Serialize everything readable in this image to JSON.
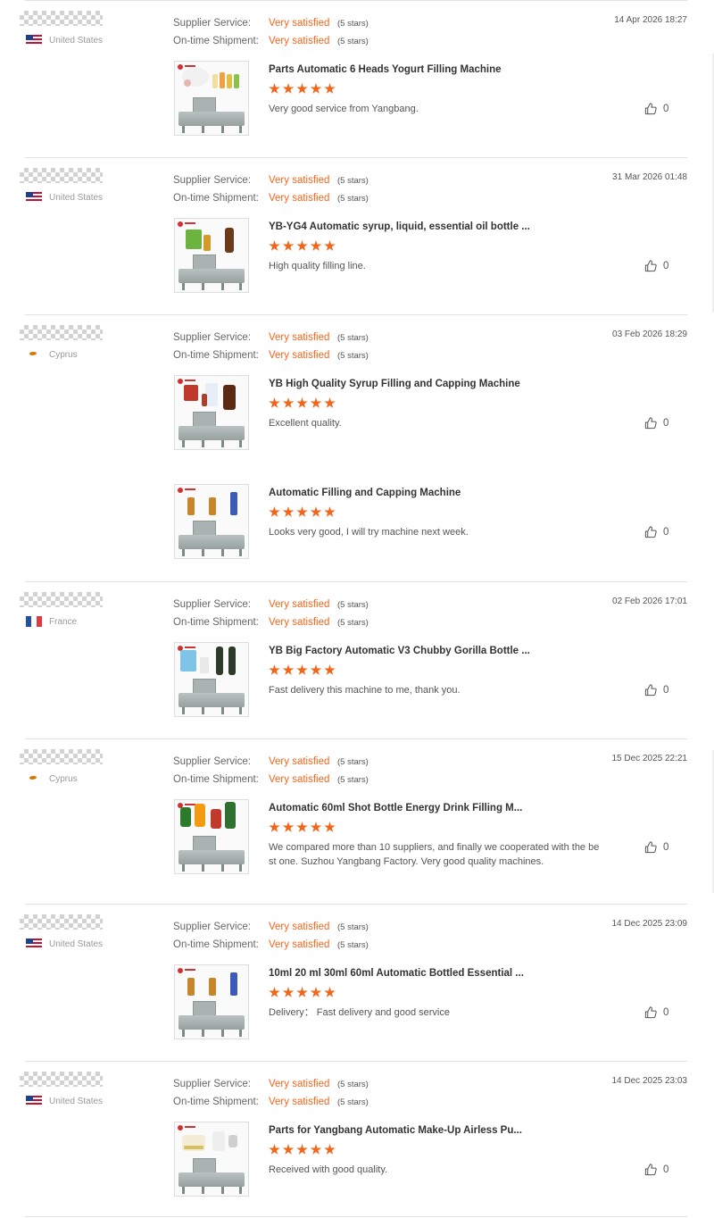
{
  "ratings_labels": {
    "supplier_service": "Supplier Service:",
    "on_time_shipment": "On-time Shipment:"
  },
  "colors": {
    "accent": "#f2661b",
    "text": "#333333",
    "muted": "#999999"
  },
  "reviews": [
    {
      "country": "United States",
      "flag": "us",
      "date": "14 Apr 2026 18:27",
      "supplier_service": "Very satisfied",
      "supplier_service_stars": "(5 stars)",
      "on_time_shipment": "Very satisfied",
      "on_time_shipment_stars": "(5 stars)",
      "products": [
        {
          "title": "Parts Automatic 6 Heads Yogurt Filling Machine",
          "rating": 5,
          "comment": "Very good service from Yangbang.",
          "likes": "0",
          "thumb": "yogurt"
        }
      ]
    },
    {
      "country": "United States",
      "flag": "us",
      "date": "31 Mar 2026 01:48",
      "supplier_service": "Very satisfied",
      "supplier_service_stars": "(5 stars)",
      "on_time_shipment": "Very satisfied",
      "on_time_shipment_stars": "(5 stars)",
      "products": [
        {
          "title": "YB-YG4 Automatic syrup, liquid, essential oil bottle ...",
          "rating": 5,
          "comment": "High quality filling line.",
          "likes": "0",
          "thumb": "syrup"
        }
      ]
    },
    {
      "country": "Cyprus",
      "flag": "cy",
      "date": "03 Feb 2026 18:29",
      "supplier_service": "Very satisfied",
      "supplier_service_stars": "(5 stars)",
      "on_time_shipment": "Very satisfied",
      "on_time_shipment_stars": "(5 stars)",
      "products": [
        {
          "title": "YB High Quality Syrup Filling and Capping Machine",
          "rating": 5,
          "comment": "Excellent quality.",
          "likes": "0",
          "thumb": "syrup2"
        },
        {
          "title": "Automatic Filling and Capping Machine",
          "rating": 5,
          "comment": "Looks very good, I will try machine next week.",
          "likes": "0",
          "thumb": "dropper"
        }
      ]
    },
    {
      "country": "France",
      "flag": "fr",
      "date": "02 Feb 2026 17:01",
      "supplier_service": "Very satisfied",
      "supplier_service_stars": "(5 stars)",
      "on_time_shipment": "Very satisfied",
      "on_time_shipment_stars": "(5 stars)",
      "products": [
        {
          "title": "YB Big Factory Automatic V3 Chubby Gorilla Bottle ...",
          "rating": 5,
          "comment": "Fast delivery this machine to me, thank you.",
          "likes": "0",
          "thumb": "gorilla"
        }
      ]
    },
    {
      "country": "Cyprus",
      "flag": "cy",
      "date": "15 Dec 2025 22:21",
      "supplier_service": "Very satisfied",
      "supplier_service_stars": "(5 stars)",
      "on_time_shipment": "Very satisfied",
      "on_time_shipment_stars": "(5 stars)",
      "products": [
        {
          "title": "Automatic 60ml Shot Bottle Energy Drink Filling M...",
          "rating": 5,
          "comment": "We compared more than 10 suppliers, and finally we cooperated with the best one. Suzhou Yangbang Factory. Very good quality machines.",
          "likes": "0",
          "thumb": "energy"
        }
      ]
    },
    {
      "country": "United States",
      "flag": "us",
      "date": "14 Dec 2025 23:09",
      "supplier_service": "Very satisfied",
      "supplier_service_stars": "(5 stars)",
      "on_time_shipment": "Very satisfied",
      "on_time_shipment_stars": "(5 stars)",
      "products": [
        {
          "title": "10ml 20 ml 30ml 60ml Automatic Bottled Essential ...",
          "rating": 5,
          "comment": "Delivery：  Fast delivery and good service",
          "likes": "0",
          "thumb": "dropper"
        }
      ]
    },
    {
      "country": "United States",
      "flag": "us",
      "date": "14 Dec 2025 23:03",
      "supplier_service": "Very satisfied",
      "supplier_service_stars": "(5 stars)",
      "on_time_shipment": "Very satisfied",
      "on_time_shipment_stars": "(5 stars)",
      "products": [
        {
          "title": "Parts for Yangbang Automatic Make-Up Airless Pu...",
          "rating": 5,
          "comment": "Received with good quality.",
          "likes": "0",
          "thumb": "cream"
        }
      ]
    }
  ]
}
